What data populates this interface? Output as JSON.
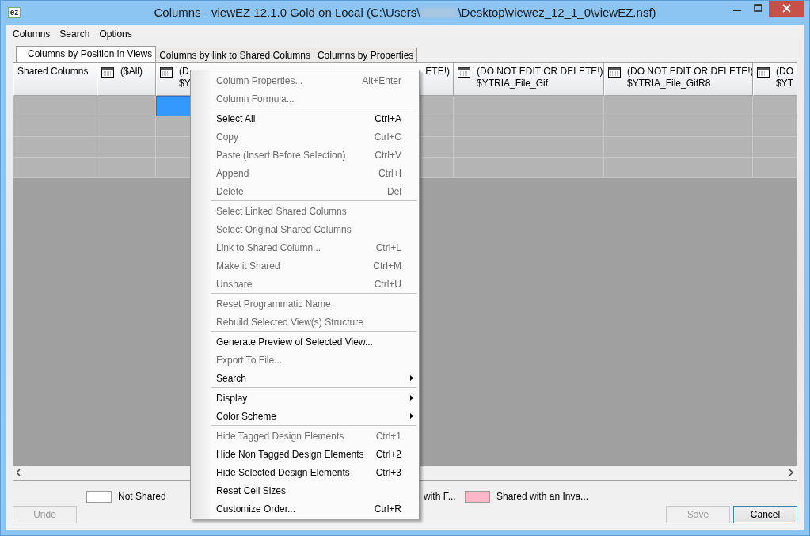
{
  "window": {
    "icon_text": "ez",
    "title_start": "Columns - viewEZ 12.1.0 Gold on Local (C:\\Users\\",
    "title_end": "\\Desktop\\viewez_12_1_0\\viewEZ.nsf)"
  },
  "menu_bar": [
    "Columns",
    "Search",
    "Options"
  ],
  "tabs": [
    {
      "label": "Columns by Position in Views",
      "selected": true
    },
    {
      "label": "Columns by link to Shared Columns",
      "selected": false
    },
    {
      "label": "Columns by Properties",
      "selected": false
    }
  ],
  "grid": {
    "columns": [
      {
        "lines": [
          "Shared Columns"
        ],
        "icon": false
      },
      {
        "lines": [
          "($All)"
        ],
        "icon": true
      },
      {
        "lines": [
          "(D",
          "$Y"
        ],
        "icon": true
      },
      {
        "lines": [
          "ETE!)"
        ],
        "icon": false
      },
      {
        "lines": [
          "(DO NOT EDIT OR DELETE!)",
          "$YTRIA_File_Gif"
        ],
        "icon": true
      },
      {
        "lines": [
          "(DO NOT EDIT OR DELETE!)",
          "$YTRIA_File_GifR8"
        ],
        "icon": true
      },
      {
        "lines": [
          "(DO",
          "$YT"
        ],
        "icon": true
      }
    ],
    "rows": [
      {
        "cells": [
          {
            "selected": false
          },
          {
            "selected": false
          },
          {
            "selected": true
          },
          {
            "selected": false
          },
          {
            "selected": false
          },
          {
            "selected": false
          },
          {
            "selected": false
          }
        ]
      },
      {
        "cells": [
          {
            "selected": false
          },
          {
            "selected": false
          },
          {
            "selected": false
          },
          {
            "selected": false
          },
          {
            "selected": false
          },
          {
            "selected": false
          },
          {
            "selected": false
          }
        ]
      },
      {
        "cells": [
          {
            "selected": false
          },
          {
            "selected": false
          },
          {
            "selected": false
          },
          {
            "selected": false
          },
          {
            "selected": false
          },
          {
            "selected": false
          },
          {
            "selected": false
          }
        ]
      },
      {
        "cells": [
          {
            "selected": false
          },
          {
            "selected": false
          },
          {
            "selected": false
          },
          {
            "selected": false
          },
          {
            "selected": false
          },
          {
            "selected": false
          },
          {
            "selected": false
          }
        ]
      }
    ]
  },
  "legend": [
    {
      "label": "Not Shared",
      "color": "#ffffff"
    },
    {
      "label": "with F..."
    },
    {
      "label": "Shared with an Inva...",
      "color": "#ffb6c8"
    }
  ],
  "buttons": [
    {
      "label": "Undo",
      "disabled": true,
      "default": false
    },
    {
      "label": "Save",
      "disabled": true,
      "default": false
    },
    {
      "label": "Cancel",
      "disabled": false,
      "default": true
    }
  ],
  "context_menu": [
    [
      {
        "label": "Column Properties...",
        "shortcut": "Alt+Enter",
        "disabled": true,
        "kind": "command"
      },
      {
        "label": "Column Formula...",
        "disabled": true,
        "kind": "command"
      }
    ],
    [
      {
        "label": "Select All",
        "shortcut": "Ctrl+A",
        "disabled": false,
        "kind": "command"
      },
      {
        "label": "Copy",
        "shortcut": "Ctrl+C",
        "disabled": true,
        "kind": "command"
      },
      {
        "label": "Paste (Insert Before Selection)",
        "shortcut": "Ctrl+V",
        "disabled": true,
        "kind": "command"
      },
      {
        "label": "Append",
        "shortcut": "Ctrl+I",
        "disabled": true,
        "kind": "command"
      },
      {
        "label": "Delete",
        "shortcut": "Del",
        "disabled": true,
        "kind": "command"
      }
    ],
    [
      {
        "label": "Select Linked Shared Columns",
        "disabled": true,
        "kind": "command"
      },
      {
        "label": "Select Original Shared Columns",
        "disabled": true,
        "kind": "command"
      },
      {
        "label": "Link to Shared Column...",
        "shortcut": "Ctrl+L",
        "disabled": true,
        "kind": "command"
      },
      {
        "label": "Make it Shared",
        "shortcut": "Ctrl+M",
        "disabled": true,
        "kind": "command"
      },
      {
        "label": "Unshare",
        "shortcut": "Ctrl+U",
        "disabled": true,
        "kind": "command"
      }
    ],
    [
      {
        "label": "Reset Programmatic Name",
        "disabled": true,
        "kind": "command"
      },
      {
        "label": "Rebuild Selected View(s) Structure",
        "disabled": true,
        "kind": "command"
      }
    ],
    [
      {
        "label": "Generate Preview of Selected View...",
        "disabled": false,
        "kind": "command"
      },
      {
        "label": "Export To File...",
        "disabled": true,
        "kind": "command"
      },
      {
        "label": "Search",
        "disabled": false,
        "kind": "submenu"
      }
    ],
    [
      {
        "label": "Display",
        "disabled": false,
        "kind": "submenu"
      },
      {
        "label": "Color Scheme",
        "disabled": false,
        "kind": "submenu"
      }
    ],
    [
      {
        "label": "Hide Tagged Design Elements",
        "shortcut": "Ctrl+1",
        "disabled": true,
        "kind": "command"
      },
      {
        "label": "Hide Non Tagged Design Elements",
        "shortcut": "Ctrl+2",
        "disabled": false,
        "kind": "command"
      },
      {
        "label": "Hide Selected Design Elements",
        "shortcut": "Ctrl+3",
        "disabled": false,
        "kind": "command"
      },
      {
        "label": "Reset Cell Sizes",
        "disabled": false,
        "kind": "command"
      },
      {
        "label": "Customize Order...",
        "shortcut": "Ctrl+R",
        "disabled": false,
        "kind": "command"
      }
    ]
  ]
}
